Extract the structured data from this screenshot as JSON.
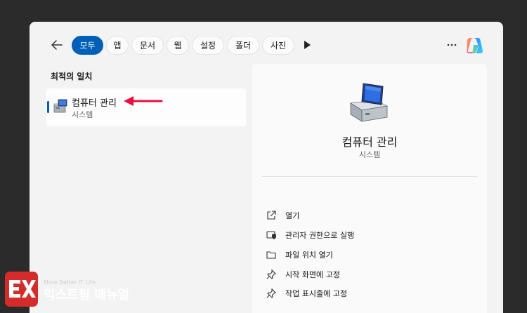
{
  "search_filters": {
    "tabs": [
      {
        "label": "모두",
        "active": true
      },
      {
        "label": "앱"
      },
      {
        "label": "문서"
      },
      {
        "label": "웹"
      },
      {
        "label": "설정"
      },
      {
        "label": "폴더"
      },
      {
        "label": "사진"
      }
    ]
  },
  "results": {
    "section_label": "최적의 일치",
    "best_match": {
      "title": "컴퓨터 관리",
      "subtitle": "시스템"
    }
  },
  "detail": {
    "title": "컴퓨터 관리",
    "subtitle": "시스템",
    "actions": [
      {
        "label": "열기",
        "icon": "open-external-icon"
      },
      {
        "label": "관리자 권한으로 실행",
        "icon": "shield-icon"
      },
      {
        "label": "파일 위치 열기",
        "icon": "folder-icon"
      },
      {
        "label": "시작 화면에 고정",
        "icon": "pin-icon"
      },
      {
        "label": "작업 표시줄에 고정",
        "icon": "pin-icon"
      }
    ]
  },
  "watermark": {
    "tagline": "More Better IT Life",
    "name": "익스트림 매뉴얼",
    "badge_text": "EX"
  },
  "colors": {
    "accent": "#005fb8",
    "annotation_arrow": "#e8123c",
    "logo_red": "#d52b2b"
  }
}
